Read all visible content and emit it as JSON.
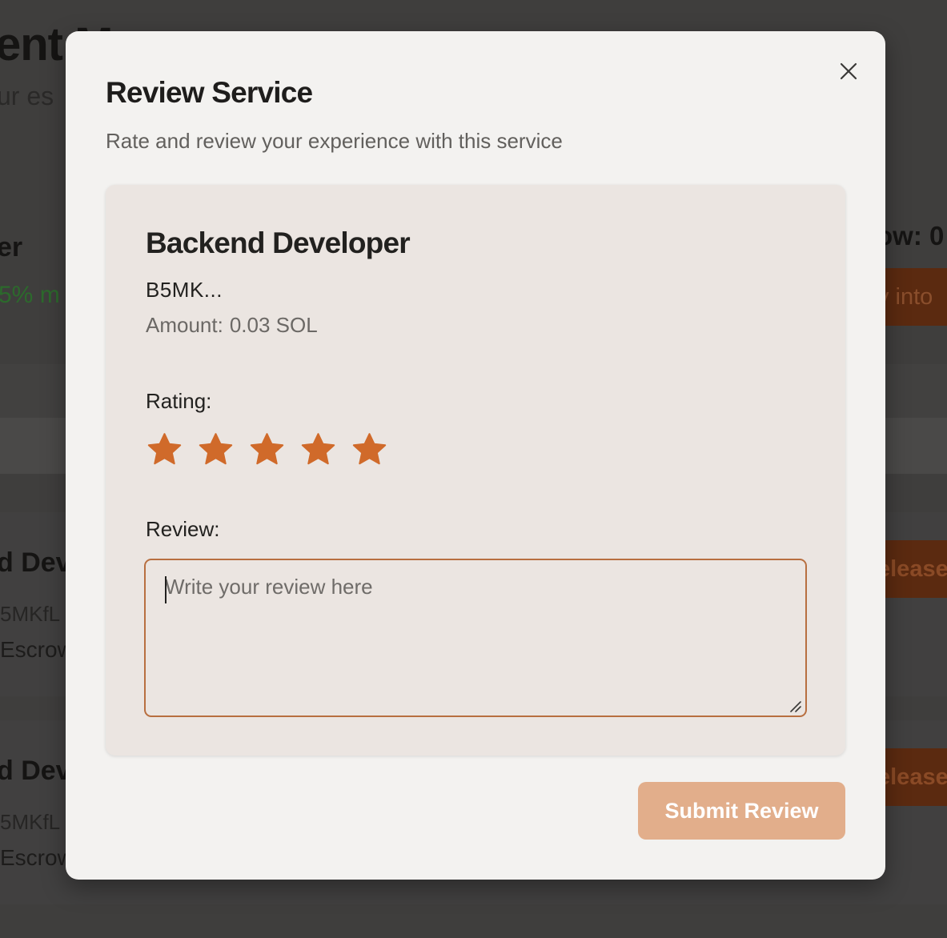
{
  "background": {
    "title": "ent Ma",
    "subtitle": "ur es",
    "section_title": "er",
    "metric": "5% m",
    "escrow_total": "ow: 0",
    "deposit_button": "y into",
    "cards": [
      {
        "title": "d Dev",
        "id": "5MKfL",
        "status": "Escrow",
        "button": "elease"
      },
      {
        "title": "d Deve",
        "id": "5MKfL",
        "status": "Escrow",
        "button": "elease"
      }
    ]
  },
  "modal": {
    "title": "Review Service",
    "subtitle": "Rate and review your experience with this service",
    "close_icon": "close-icon",
    "service": {
      "title": "Backend Developer",
      "provider_id": "B5MK...",
      "amount_label": "Amount:",
      "amount_value": "0.03 SOL"
    },
    "rating": {
      "label": "Rating:",
      "max": 5,
      "value": 5,
      "icon": "star-icon",
      "color": "#d06a2a"
    },
    "review": {
      "label": "Review:",
      "value": "",
      "placeholder": "Write your review here"
    },
    "submit_label": "Submit Review",
    "accent_color": "#b86f40",
    "submit_color": "#e2ae8b"
  }
}
